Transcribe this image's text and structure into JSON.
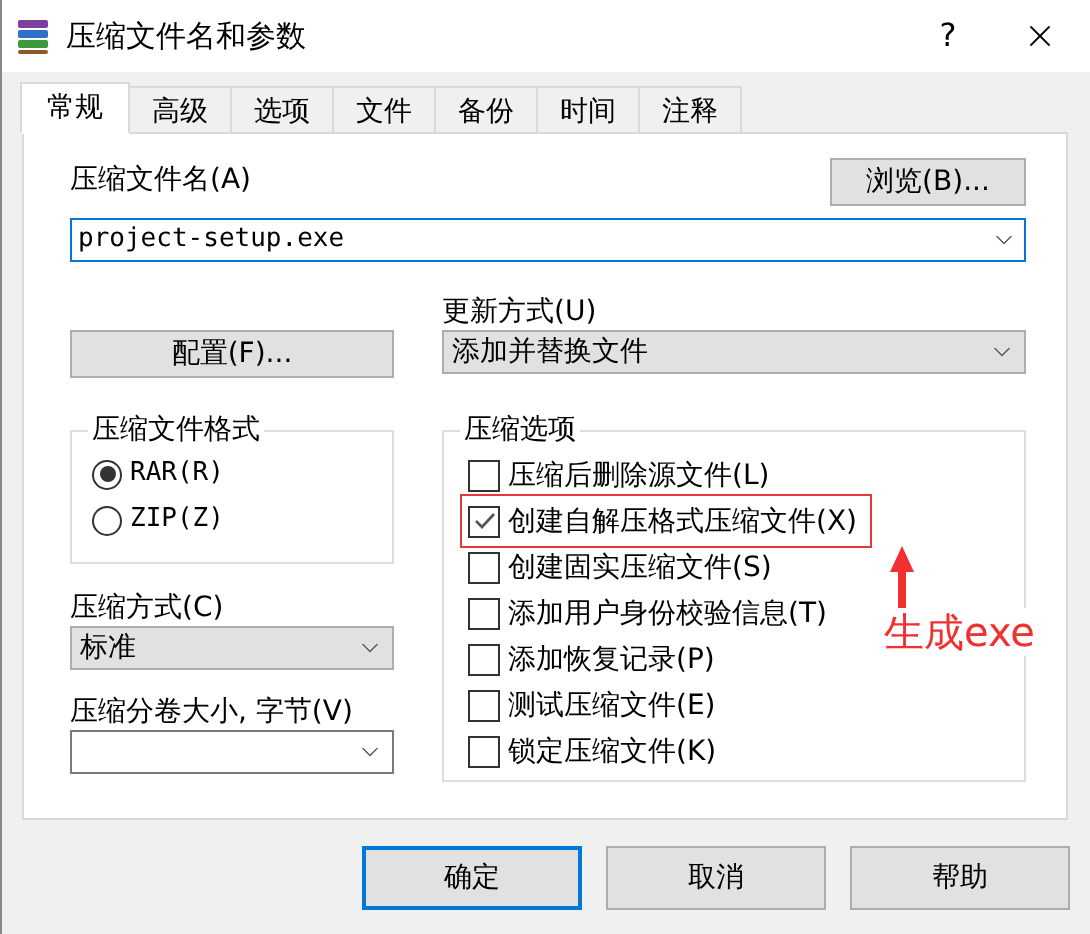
{
  "window": {
    "title": "压缩文件名和参数",
    "help": "?"
  },
  "tabs": [
    {
      "label": "常规",
      "selected": true
    },
    {
      "label": "高级",
      "selected": false
    },
    {
      "label": "选项",
      "selected": false
    },
    {
      "label": "文件",
      "selected": false
    },
    {
      "label": "备份",
      "selected": false
    },
    {
      "label": "时间",
      "selected": false
    },
    {
      "label": "注释",
      "selected": false
    }
  ],
  "archive_name": {
    "label": "压缩文件名(A)",
    "value": "project-setup.exe",
    "browse_button": "浏览(B)..."
  },
  "profiles_button": "配置(F)...",
  "update_mode": {
    "label": "更新方式(U)",
    "value": "添加并替换文件"
  },
  "archive_format": {
    "title": "压缩文件格式",
    "options": [
      {
        "label": "RAR(R)",
        "selected": true
      },
      {
        "label": "ZIP(Z)",
        "selected": false
      }
    ]
  },
  "compression_method": {
    "label": "压缩方式(C)",
    "value": "标准"
  },
  "split_volumes": {
    "label": "压缩分卷大小, 字节(V)"
  },
  "archiving_options": {
    "title": "压缩选项",
    "items": [
      {
        "label": "压缩后删除源文件(L)",
        "checked": false,
        "highlighted": false
      },
      {
        "label": "创建自解压格式压缩文件(X)",
        "checked": true,
        "highlighted": true
      },
      {
        "label": "创建固实压缩文件(S)",
        "checked": false,
        "highlighted": false
      },
      {
        "label": "添加用户身份校验信息(T)",
        "checked": false,
        "highlighted": false
      },
      {
        "label": "添加恢复记录(P)",
        "checked": false,
        "highlighted": false
      },
      {
        "label": "测试压缩文件(E)",
        "checked": false,
        "highlighted": false
      },
      {
        "label": "锁定压缩文件(K)",
        "checked": false,
        "highlighted": false
      }
    ]
  },
  "annotation": {
    "text": "生成exe"
  },
  "buttons": [
    {
      "label": "确定",
      "default": true
    },
    {
      "label": "取消",
      "default": false
    },
    {
      "label": "帮助",
      "default": false
    }
  ]
}
